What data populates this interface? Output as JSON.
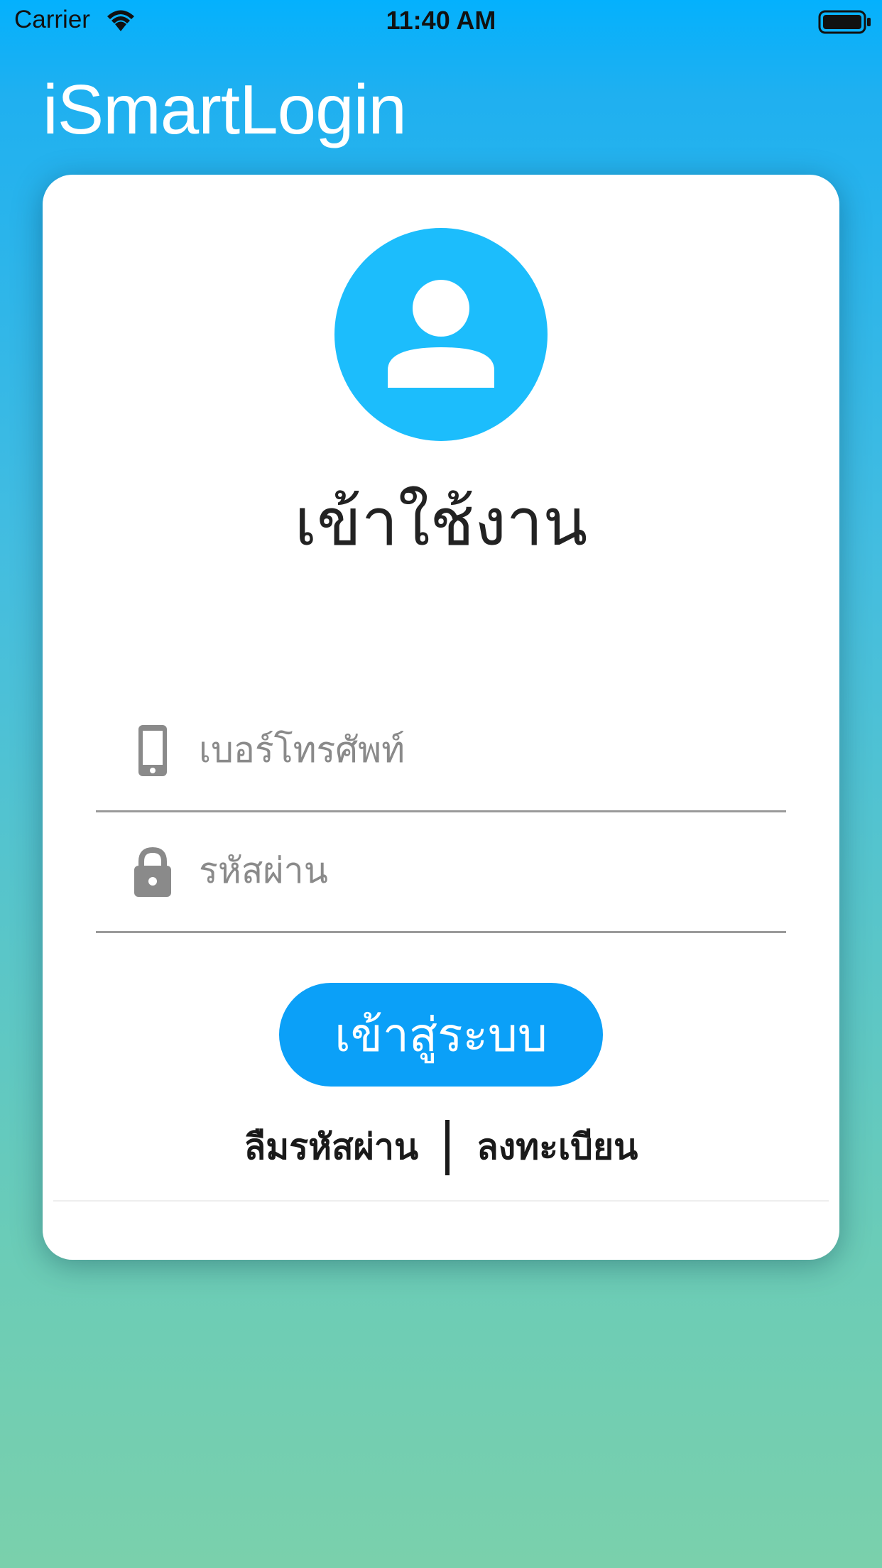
{
  "status_bar": {
    "carrier": "Carrier",
    "time": "11:40 AM"
  },
  "app": {
    "title": "iSmartLogin"
  },
  "login_card": {
    "heading": "เข้าใช้งาน",
    "phone_field": {
      "placeholder": "เบอร์โทรศัพท์",
      "value": "",
      "icon": "mobile-phone-icon"
    },
    "password_field": {
      "placeholder": "รหัสผ่าน",
      "value": "",
      "icon": "lock-icon"
    },
    "login_button": "เข้าสู่ระบบ",
    "forgot_password_link": "ลืมรหัสผ่าน",
    "register_link": "ลงทะเบียน"
  },
  "colors": {
    "background_top": "#04b1fd",
    "background_bottom": "#7ad0ac",
    "avatar": "#1cbdfc",
    "button": "#0ba0f8"
  }
}
